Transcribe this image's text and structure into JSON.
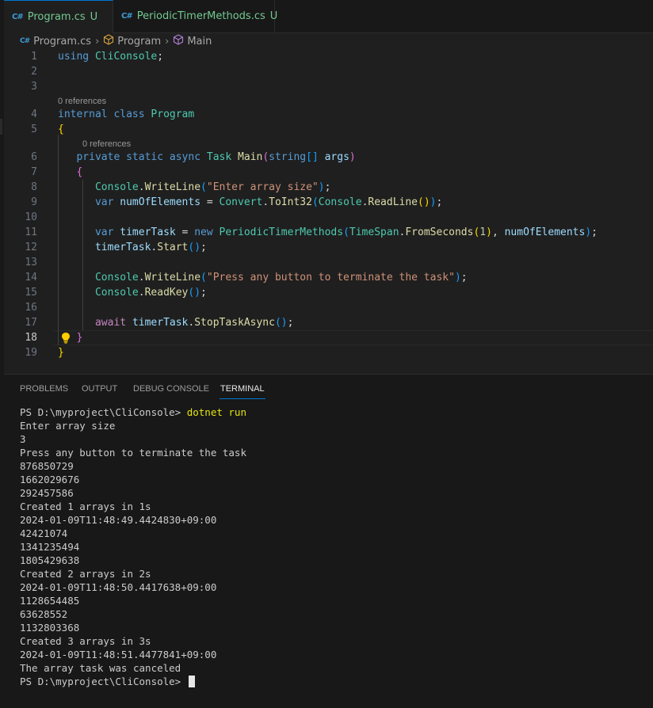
{
  "tabs": [
    {
      "icon": "C#",
      "name": "Program.cs",
      "status": "U",
      "active": true,
      "unsaved": true
    },
    {
      "icon": "C#",
      "name": "PeriodicTimerMethods.cs",
      "status": "U",
      "active": false
    }
  ],
  "breadcrumb": {
    "file": "Program.cs",
    "class": "Program",
    "method": "Main",
    "file_icon": "C#"
  },
  "editor": {
    "current_line": 18,
    "lens_class": "0 references",
    "lens_method": "0 references",
    "line_numbers": [
      "1",
      "2",
      "3",
      "4",
      "5",
      "6",
      "7",
      "8",
      "9",
      "10",
      "11",
      "12",
      "13",
      "14",
      "15",
      "16",
      "17",
      "18",
      "19"
    ],
    "l1": {
      "kw": "using",
      "ns": "CliConsole",
      "semi": ";"
    },
    "l4": {
      "kw1": "internal",
      "kw2": "class",
      "name": "Program"
    },
    "l5": {
      "brace": "{"
    },
    "l6": {
      "kw1": "private",
      "kw2": "static",
      "kw3": "async",
      "type": "Task",
      "name": "Main",
      "open": "(",
      "ptype": "string",
      "brk": "[]",
      "param": "args",
      "close": ")"
    },
    "l7": {
      "brace": "{"
    },
    "l8": {
      "cls": "Console",
      "dot": ".",
      "fn": "WriteLine",
      "open": "(",
      "str": "\"Enter array size\"",
      "close": ")",
      "semi": ";"
    },
    "l9": {
      "kw": "var",
      "var": "numOfElements",
      "eq": " = ",
      "cls": "Convert",
      "dot1": ".",
      "fn": "ToInt32",
      "open1": "(",
      "cls2": "Console",
      "dot2": ".",
      "fn2": "ReadLine",
      "open2": "()",
      "close1": ")",
      "semi": ";"
    },
    "l11": {
      "kw": "var",
      "var": "timerTask",
      "eq": " = ",
      "new": "new",
      "cls": "PeriodicTimerMethods",
      "open1": "(",
      "cls2": "TimeSpan",
      "dot": ".",
      "fn": "FromSeconds",
      "open2": "(",
      "num": "1",
      "close2": ")",
      "comma": ", ",
      "arg": "numOfElements",
      "close1": ")",
      "semi": ";"
    },
    "l12": {
      "var": "timerTask",
      "dot": ".",
      "fn": "Start",
      "parens": "()",
      "semi": ";"
    },
    "l14": {
      "cls": "Console",
      "dot": ".",
      "fn": "WriteLine",
      "open": "(",
      "str": "\"Press any button to terminate the task\"",
      "close": ")",
      "semi": ";"
    },
    "l15": {
      "cls": "Console",
      "dot": ".",
      "fn": "ReadKey",
      "parens": "()",
      "semi": ";"
    },
    "l17": {
      "kw": "await",
      "var": "timerTask",
      "dot": ".",
      "fn": "StopTaskAsync",
      "parens": "()",
      "semi": ";"
    },
    "l18": {
      "brace": "}"
    },
    "l19": {
      "brace": "}"
    }
  },
  "panel": {
    "tabs": [
      "PROBLEMS",
      "OUTPUT",
      "DEBUG CONSOLE",
      "TERMINAL"
    ],
    "active_tab": "TERMINAL",
    "prompt": "PS D:\\myproject\\CliConsole> ",
    "command": "dotnet run",
    "output_lines": [
      "Enter array size",
      "3",
      "Press any button to terminate the task",
      "876850729",
      "1662029676",
      "292457586",
      "Created 1 arrays in 1s",
      "2024-01-09T11:48:49.4424830+09:00",
      "42421074",
      "1341235494",
      "1805429638",
      "Created 2 arrays in 2s",
      "2024-01-09T11:48:50.4417638+09:00",
      "1128654485",
      "63628552",
      "1132803368",
      "Created 3 arrays in 3s",
      "2024-01-09T11:48:51.4477841+09:00",
      "The array task was canceled"
    ],
    "final_prompt": "PS D:\\myproject\\CliConsole> "
  }
}
